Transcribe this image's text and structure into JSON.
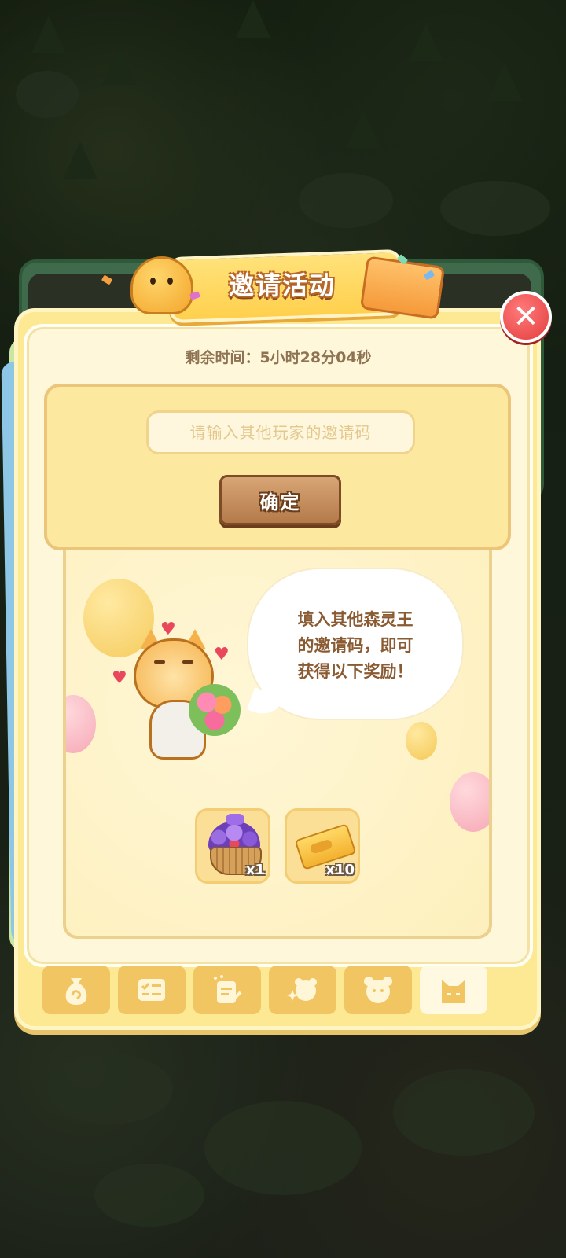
{
  "popup": {
    "title": "邀请活动",
    "timer_text": "剩余时间：5小时28分04秒",
    "close_symbol": "✕"
  },
  "invite": {
    "placeholder": "请输入其他玩家的邀请码",
    "confirm_label": "确定"
  },
  "speech": {
    "line1": "填入其他森灵王",
    "line2": "的邀请码，即可",
    "line3": "获得以下奖励！"
  },
  "rewards": [
    {
      "icon": "flower-basket-icon",
      "quantity": "x1"
    },
    {
      "icon": "ticket-icon",
      "quantity": "x10"
    }
  ],
  "tabs": [
    {
      "icon": "money-bag-icon",
      "active": false
    },
    {
      "icon": "checklist-icon",
      "active": false
    },
    {
      "icon": "notice-board-icon",
      "active": false
    },
    {
      "icon": "sparkle-bear-icon",
      "active": false
    },
    {
      "icon": "bear-face-icon",
      "active": false
    },
    {
      "icon": "cat-face-icon",
      "active": true
    }
  ],
  "colors": {
    "panel": "#fde893",
    "title_outline": "#b6672a",
    "button": "#b47a4a",
    "close": "#e43d3d"
  }
}
